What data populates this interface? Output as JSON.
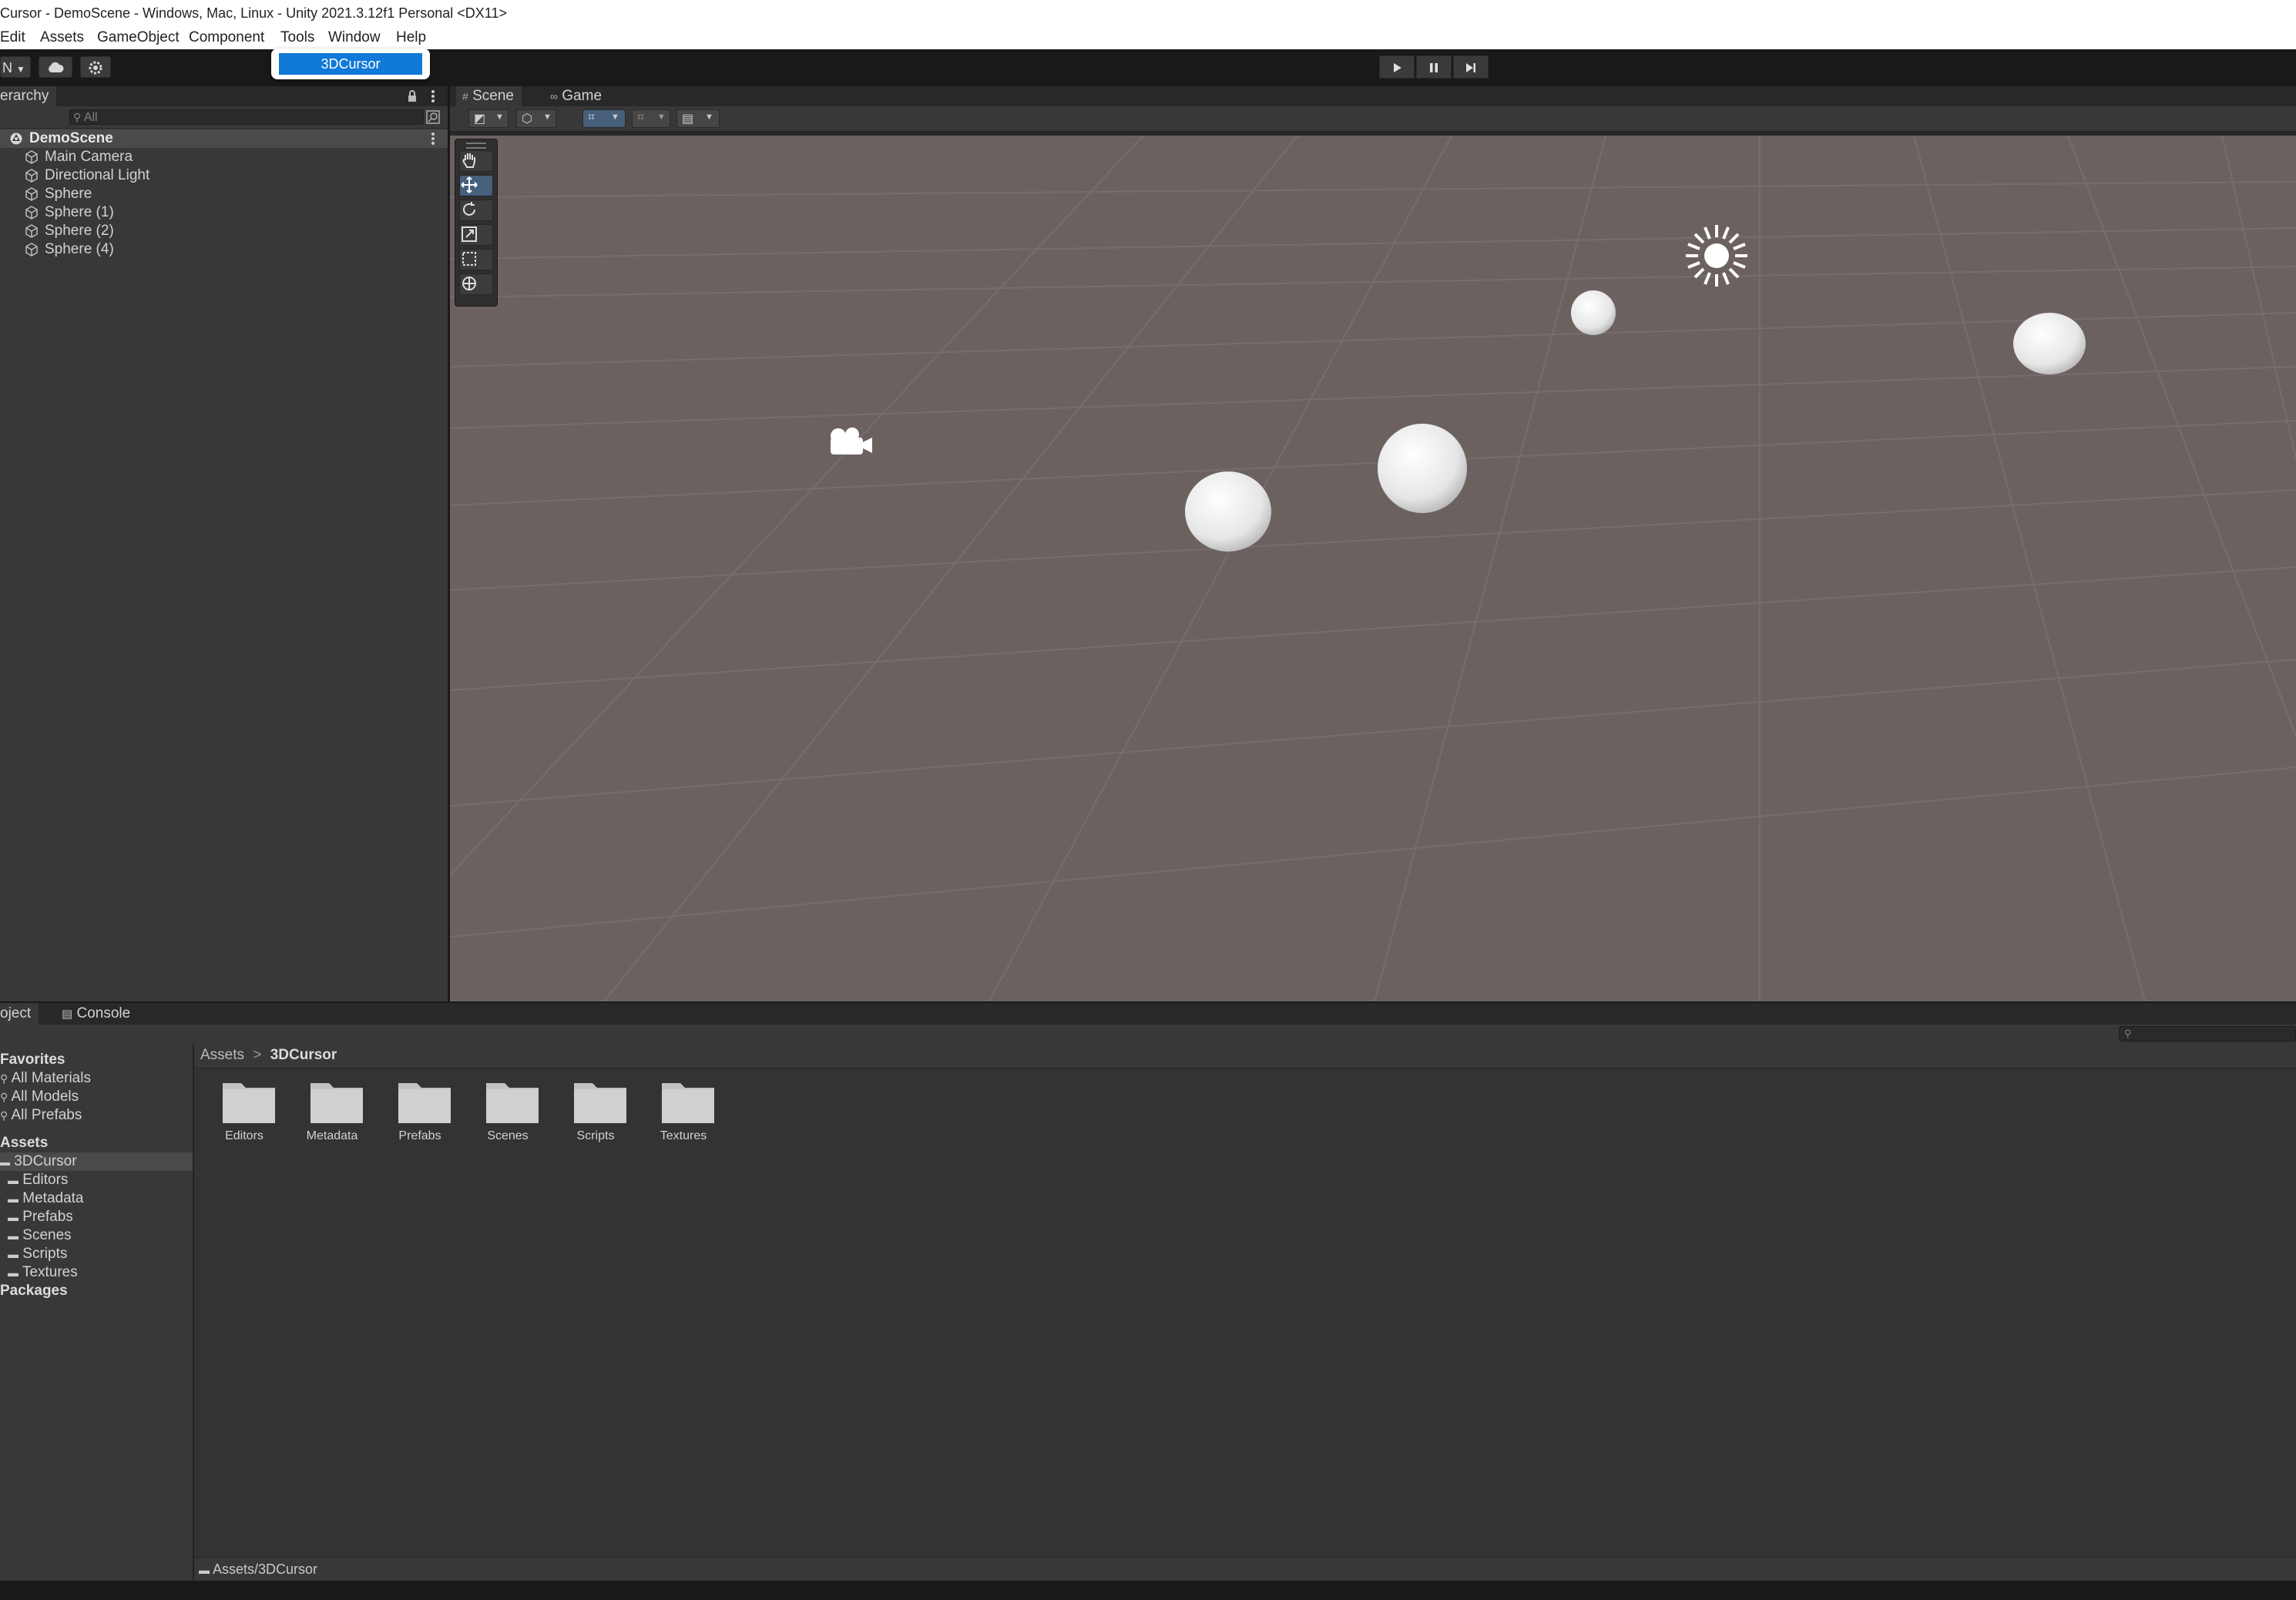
{
  "window": {
    "title": "Cursor - DemoScene - Windows, Mac, Linux - Unity 2021.3.12f1 Personal <DX11>"
  },
  "menubar": {
    "items": [
      "Edit",
      "Assets",
      "GameObject",
      "Component",
      "Tools",
      "Window",
      "Help"
    ]
  },
  "tools_menu": {
    "open_item": "3DCursor"
  },
  "toolbar": {
    "account_label": "N",
    "play_icon": "play-icon",
    "pause_icon": "pause-icon",
    "step_icon": "step-icon"
  },
  "hierarchy": {
    "tab_label": "erarchy",
    "search_placeholder": "All",
    "scene_name": "DemoScene",
    "objects": [
      "Main Camera",
      "Directional Light",
      "Sphere",
      "Sphere (1)",
      "Sphere (2)",
      "Sphere (4)"
    ]
  },
  "scene_view": {
    "tabs": [
      "Scene",
      "Game"
    ],
    "active_tab": "Scene",
    "background_color": "#6b6260"
  },
  "bottom_panel": {
    "tabs": [
      "oject",
      "Console"
    ],
    "breadcrumb_root": "Assets",
    "breadcrumb_separator": ">",
    "breadcrumb_current": "3DCursor",
    "favorites_header": "Favorites",
    "favorites": [
      "All Materials",
      "All Models",
      "All Prefabs"
    ],
    "assets_header": "Assets",
    "assets_root": "3DCursor",
    "asset_folders": [
      "Editors",
      "Metadata",
      "Prefabs",
      "Scenes",
      "Scripts",
      "Textures"
    ],
    "packages_header": "Packages",
    "folder_tiles": [
      "Editors",
      "Metadata",
      "Prefabs",
      "Scenes",
      "Scripts",
      "Textures"
    ],
    "status_path": "Assets/3DCursor"
  },
  "colors": {
    "accent": "#1179d8",
    "panel": "#383838",
    "active_tool": "#46607c"
  }
}
